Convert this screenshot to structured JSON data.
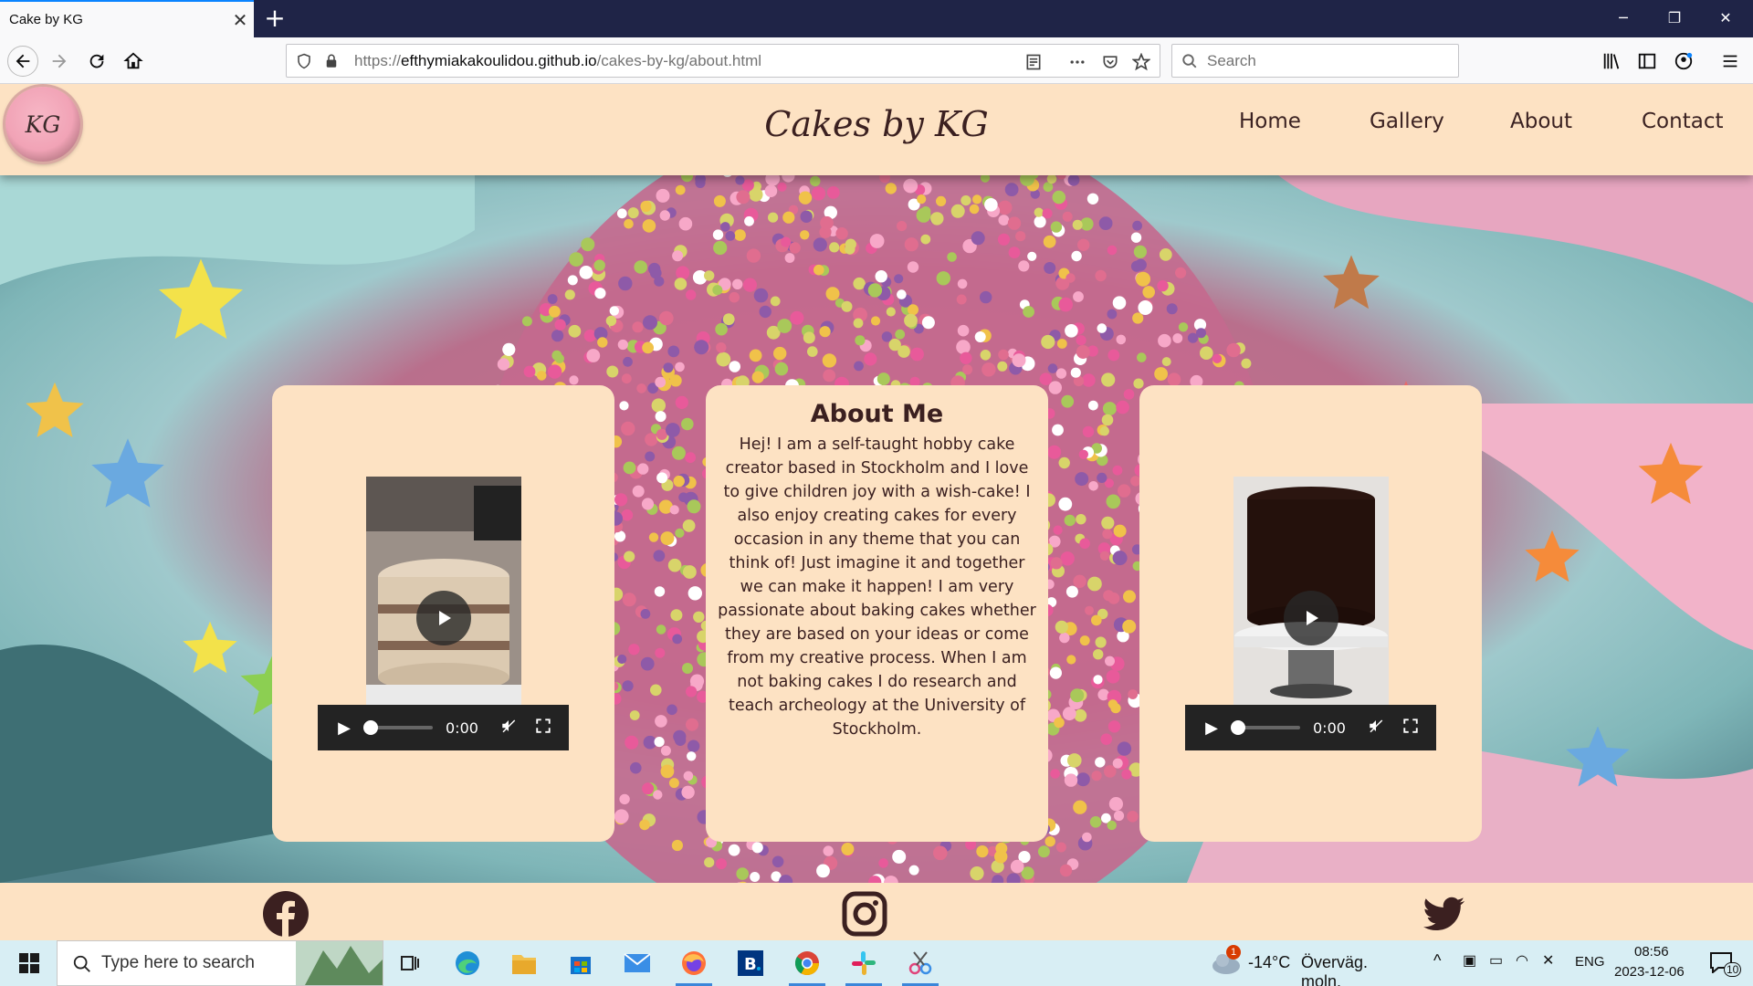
{
  "browser": {
    "tab_title": "Cake by KG",
    "tab_close": "✕",
    "new_tab": "+",
    "url_host": "efthymiakakoulidou.github.io",
    "url_prefix": "https://",
    "url_path": "/cakes-by-kg/about.html",
    "search_placeholder": "Search",
    "window_controls": [
      "─",
      "❐",
      "✕"
    ]
  },
  "site": {
    "logo_text": "KG",
    "title": "Cakes by KG",
    "nav": [
      "Home",
      "Gallery",
      "About",
      "Contact"
    ]
  },
  "about": {
    "heading": "About Me",
    "body": "Hej! I am a self-taught hobby cake creator based in Stockholm and I love to give children joy with a wish-cake! I also enjoy creating cakes for every occasion in any theme that you can think of! Just imagine it and together we can make it happen! I am very passionate about baking cakes whether they are based on your ideas or come from my creative process. When I am not baking cakes I do research and teach archeology at the University of Stockholm."
  },
  "videos": [
    {
      "time": "0:00",
      "progress": 0
    },
    {
      "time": "0:00",
      "progress": 0
    }
  ],
  "footer": {
    "icons": [
      "facebook-icon",
      "instagram-icon",
      "twitter-icon"
    ]
  },
  "taskbar": {
    "search_placeholder": "Type here to search",
    "weather_temp": "-14°C",
    "weather_text": "Överväg. moln.",
    "weather_badge": "1",
    "language": "ENG",
    "time": "08:56",
    "date": "2023-12-06",
    "notification_count": "10"
  },
  "colors": {
    "page_bg": "#fde2c3",
    "text": "#3b2020",
    "browser_accent": "#0a84ff",
    "tabbar": "#1f2447"
  }
}
